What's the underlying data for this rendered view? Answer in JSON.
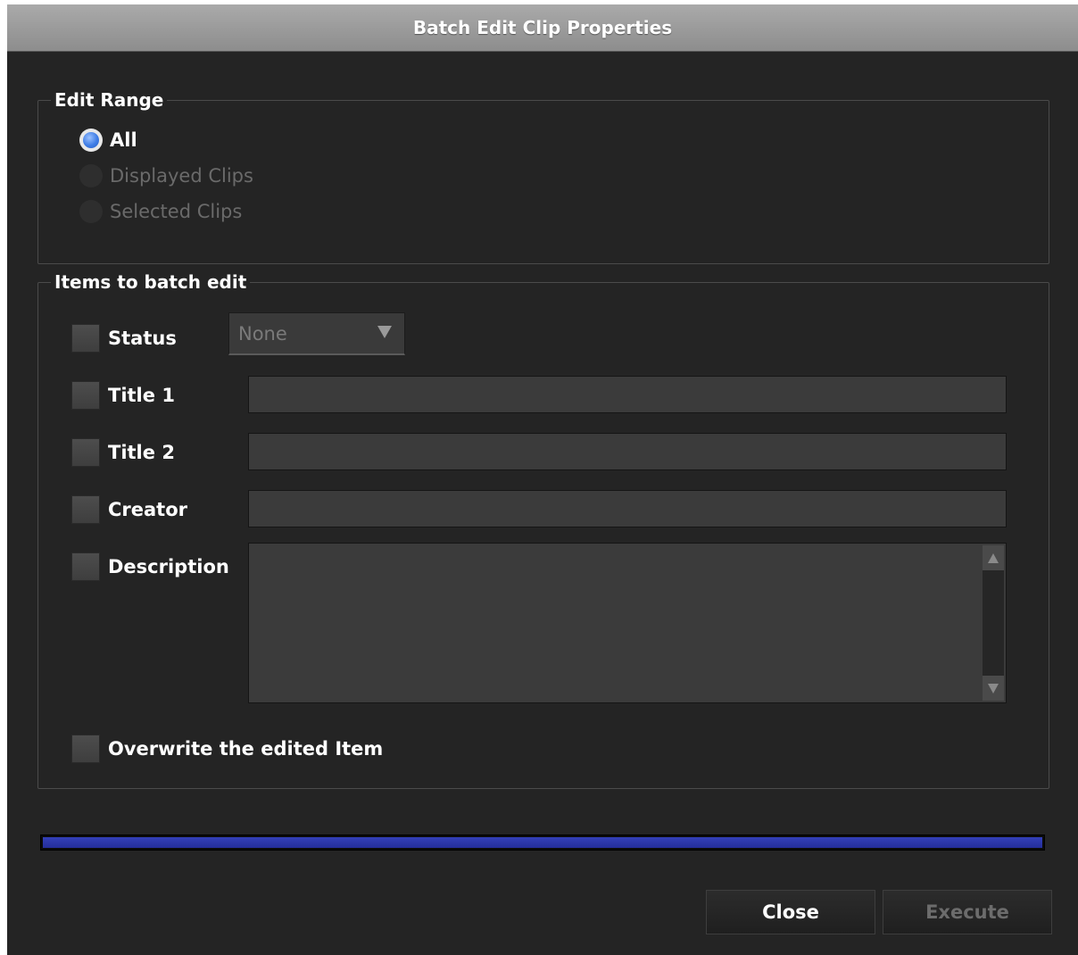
{
  "window": {
    "title": "Batch Edit Clip Properties"
  },
  "edit_range": {
    "legend": "Edit Range",
    "options": [
      {
        "label": "All",
        "selected": true,
        "enabled": true
      },
      {
        "label": "Displayed Clips",
        "selected": false,
        "enabled": false
      },
      {
        "label": "Selected Clips",
        "selected": false,
        "enabled": false
      }
    ]
  },
  "items": {
    "legend": "Items to batch edit",
    "status": {
      "label": "Status",
      "checked": false,
      "dropdown_value": "None"
    },
    "title1": {
      "label": "Title 1",
      "checked": false,
      "value": ""
    },
    "title2": {
      "label": "Title 2",
      "checked": false,
      "value": ""
    },
    "creator": {
      "label": "Creator",
      "checked": false,
      "value": ""
    },
    "description": {
      "label": "Description",
      "checked": false,
      "value": ""
    },
    "overwrite": {
      "label": "Overwrite the edited Item",
      "checked": false
    }
  },
  "progress": {
    "fraction": 1.0,
    "color": "#2b34a8"
  },
  "buttons": {
    "close_label": "Close",
    "execute_label": "Execute"
  },
  "colors": {
    "background": "#242424",
    "accent": "#3f7de6"
  }
}
